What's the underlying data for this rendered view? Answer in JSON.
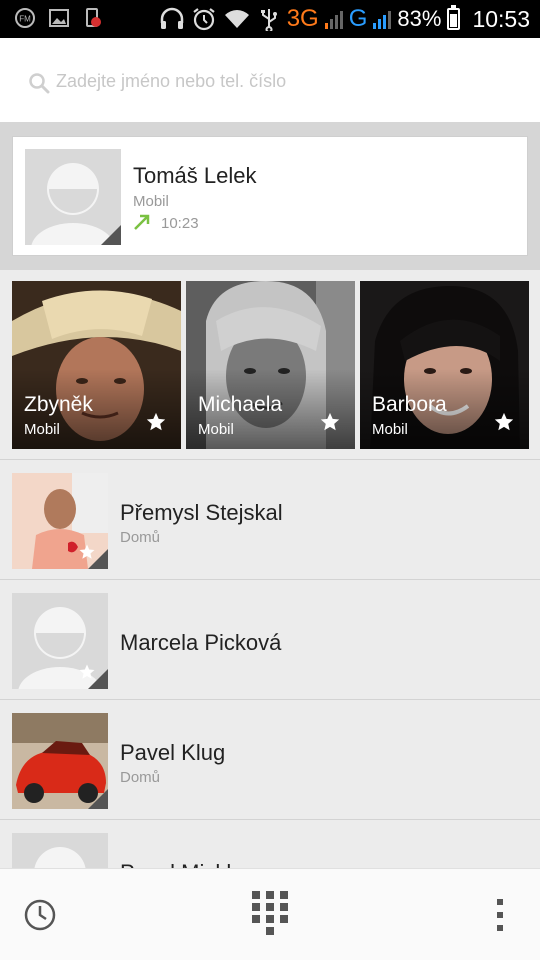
{
  "status_bar": {
    "network_3g": "3G",
    "network_g": "G",
    "battery_text": "83%",
    "time": "10:53",
    "battery_level": 0.83,
    "icons": [
      "fm-radio-icon",
      "image-icon",
      "phone-notification-icon",
      "headphones-icon",
      "alarm-icon",
      "wifi-icon",
      "usb-icon",
      "signal-3g-icon",
      "signal-g-icon",
      "battery-icon"
    ]
  },
  "search": {
    "placeholder": "Zadejte jméno nebo tel. číslo",
    "value": ""
  },
  "recent_call": {
    "name": "Tomáš Lelek",
    "type": "Mobil",
    "time": "10:23",
    "direction": "outgoing",
    "arrow_color": "#7ac142"
  },
  "favorites": [
    {
      "name": "Zbyněk",
      "type": "Mobil"
    },
    {
      "name": "Michaela",
      "type": "Mobil"
    },
    {
      "name": "Barbora",
      "type": "Mobil"
    }
  ],
  "contacts": [
    {
      "name": "Přemysl Stejskal",
      "sub": "Domů"
    },
    {
      "name": "Marcela Picková",
      "sub": ""
    },
    {
      "name": "Pavel Klug",
      "sub": "Domů"
    },
    {
      "name": "Pavel Mickl",
      "sub": ""
    }
  ],
  "bottom_nav": {
    "icons": [
      "history-clock-icon",
      "dialpad-icon",
      "overflow-menu-icon"
    ]
  }
}
